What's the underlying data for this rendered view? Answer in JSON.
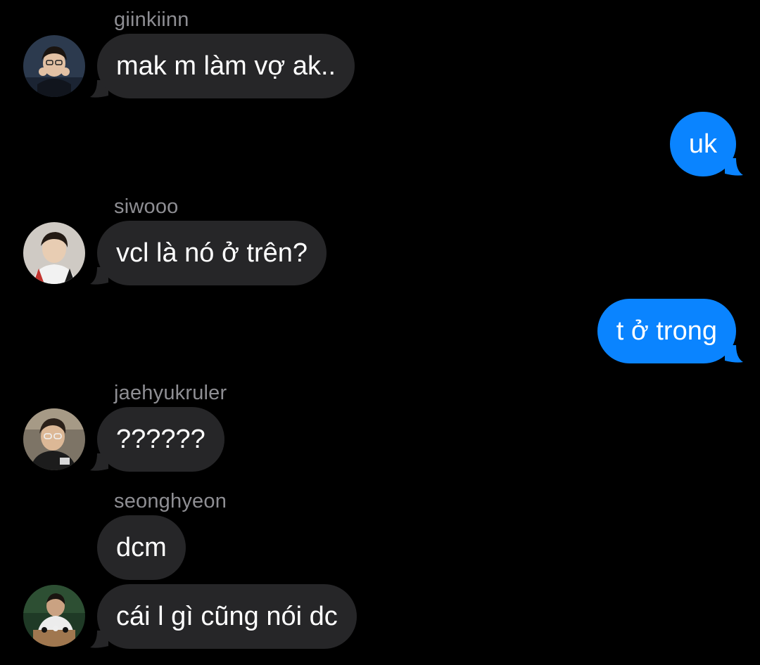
{
  "conversation": {
    "messages": [
      {
        "sender": "giinkiinn",
        "text": "mak m làm vợ ak..",
        "direction": "incoming",
        "avatar": "avatar-giinkiinn"
      },
      {
        "text": "uk",
        "direction": "outgoing"
      },
      {
        "sender": "siwooo",
        "text": "vcl là nó ở trên?",
        "direction": "incoming",
        "avatar": "avatar-siwooo"
      },
      {
        "text": "t ở trong",
        "direction": "outgoing"
      },
      {
        "sender": "jaehyukruler",
        "text": "??????",
        "direction": "incoming",
        "avatar": "avatar-jaehyukruler"
      },
      {
        "sender": "seonghyeon",
        "text": "dcm",
        "direction": "incoming"
      },
      {
        "text": "cái l gì cũng nói dc",
        "direction": "incoming",
        "avatar": "avatar-seonghyeon"
      }
    ]
  },
  "colors": {
    "background": "#000000",
    "incoming_bubble": "#262628",
    "outgoing_bubble": "#0a84ff",
    "sender_name": "#8e8e93",
    "message_text": "#ffffff"
  }
}
